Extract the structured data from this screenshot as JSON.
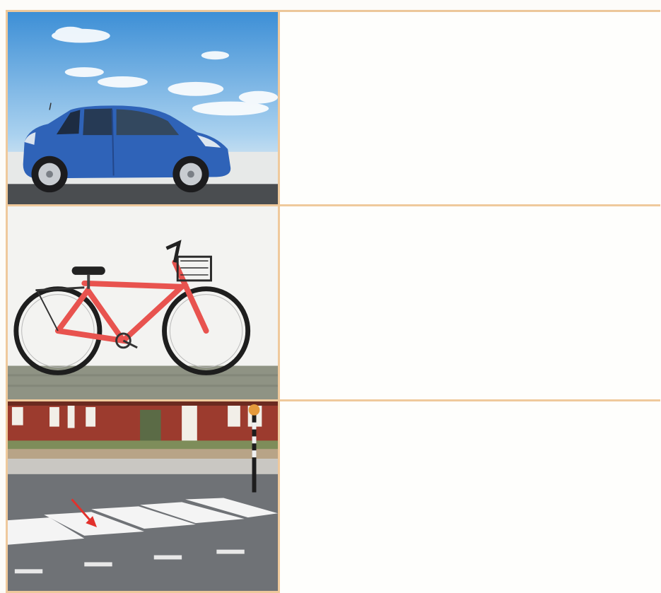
{
  "worksheet": {
    "rows": [
      {
        "picture": "blue-car",
        "answer": ""
      },
      {
        "picture": "red-bicycle",
        "answer": ""
      },
      {
        "picture": "zebra-crossing-street",
        "answer": ""
      }
    ]
  },
  "colors": {
    "frame": "#efc99c",
    "car": "#2f63b8",
    "bicycle": "#e8534f",
    "sky": "#4a9ad8",
    "brick": "#9c3b2e",
    "arrow": "#e2312c"
  }
}
